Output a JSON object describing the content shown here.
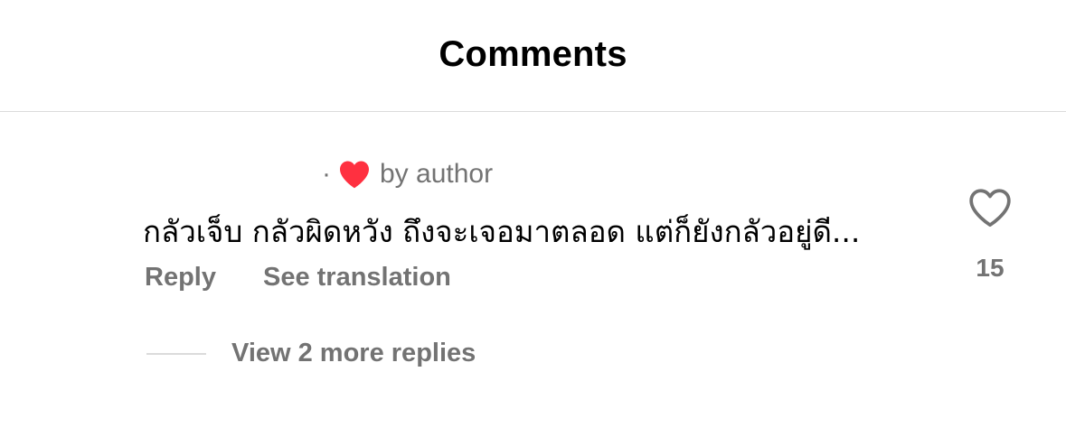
{
  "header": {
    "title": "Comments"
  },
  "comment": {
    "meta": {
      "separator": "·",
      "liked_by_author_icon": "heart-filled-icon",
      "liked_by_author_color": "#ff3040",
      "label": "by author"
    },
    "text": "กลัวเจ็บ กลัวผิดหวัง ถึงจะเจอมาตลอด แต่ก็ยังกลัวอยู่ดี...",
    "actions": {
      "reply_label": "Reply",
      "translate_label": "See translation"
    },
    "like": {
      "icon": "heart-outline-icon",
      "count": "15"
    },
    "replies": {
      "label": "View 2 more replies"
    }
  },
  "colors": {
    "text_primary": "#000000",
    "text_secondary": "#737373",
    "divider": "#dbdbdb",
    "heart_red": "#ff3040"
  }
}
